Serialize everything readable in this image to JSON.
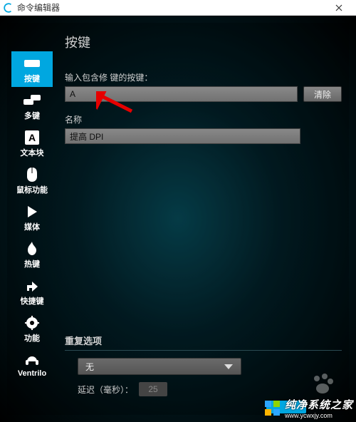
{
  "window": {
    "title": "命令编辑器"
  },
  "sidebar": {
    "items": [
      {
        "label": "按键"
      },
      {
        "label": "多键"
      },
      {
        "label": "文本块"
      },
      {
        "label": "鼠标功能"
      },
      {
        "label": "媒体"
      },
      {
        "label": "热键"
      },
      {
        "label": "快捷键"
      },
      {
        "label": "功能"
      },
      {
        "label": "Ventrilo"
      }
    ]
  },
  "main": {
    "heading": "按键",
    "key_label": "输入包含修    键的按键：",
    "key_value": "A",
    "clear_btn": "清除",
    "name_label": "名称",
    "name_value": "提高 DPI"
  },
  "repeat": {
    "title": "重复选项",
    "select_value": "无",
    "delay_label": "延迟（毫秒）：",
    "delay_value": "25"
  },
  "watermark": {
    "brand": "纯净系统之家",
    "url": "www.ycwxjy.com"
  }
}
